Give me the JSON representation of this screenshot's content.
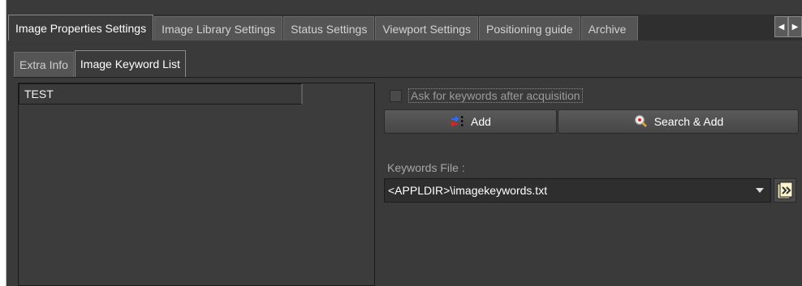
{
  "main_tabs": [
    {
      "label": "Image Properties Settings",
      "active": true
    },
    {
      "label": "Image Library Settings",
      "active": false
    },
    {
      "label": "Status Settings",
      "active": false
    },
    {
      "label": "Viewport Settings",
      "active": false
    },
    {
      "label": "Positioning guide",
      "active": false
    },
    {
      "label": "Archive",
      "active": false
    }
  ],
  "tab_scroll": {
    "left_icon": "triangle-left-icon",
    "right_icon": "triangle-right-icon"
  },
  "sub_tabs": [
    {
      "label": "Extra Info",
      "active": false
    },
    {
      "label": "Image Keyword List",
      "active": true
    }
  ],
  "keyword_list": {
    "items": [
      "TEST"
    ]
  },
  "options": {
    "ask_keywords_label": "Ask for keywords after acquisition",
    "ask_keywords_checked": false
  },
  "buttons": {
    "add_label": "Add",
    "add_icon": "add-arrows-icon",
    "search_add_label": "Search & Add",
    "search_icon": "magnifier-icon"
  },
  "keywords_file": {
    "label": "Keywords File :",
    "value": "<APPLDIR>\\imagekeywords.txt",
    "browse_icon": "folder-browse-icon"
  },
  "colors": {
    "panel_bg": "#3a3a3a",
    "tab_bg": "#555555",
    "accent_red": "#e02020",
    "accent_blue": "#2a6cff"
  }
}
